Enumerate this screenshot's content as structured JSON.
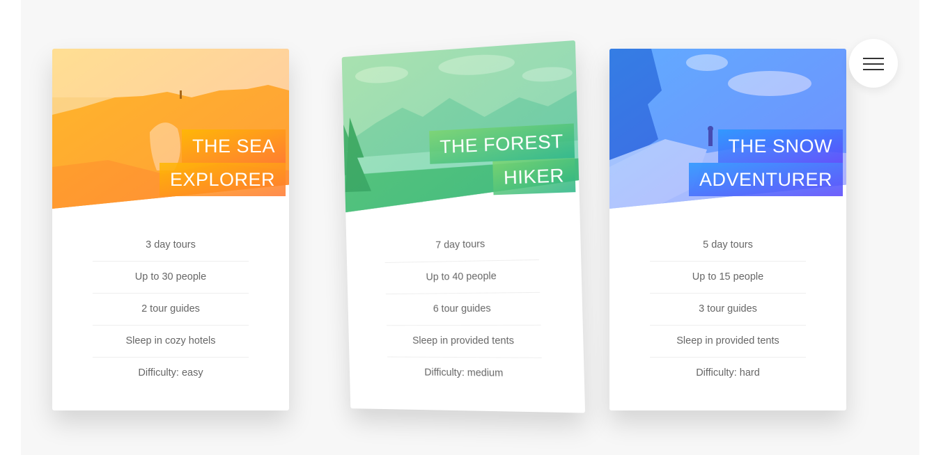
{
  "colors": {
    "sea_light": "#ffb900",
    "sea_dark": "#ff7730",
    "forest_light": "#7ed56f",
    "forest_dark": "#28b485",
    "snow_light": "#2998ff",
    "snow_dark": "#5643fa"
  },
  "nav": {
    "icon": "hamburger-menu-icon"
  },
  "cards": [
    {
      "heading": [
        "THE SEA",
        "EXPLORER"
      ],
      "details": [
        "3 day tours",
        "Up to 30 people",
        "2 tour guides",
        "Sleep in cozy hotels",
        "Difficulty: easy"
      ]
    },
    {
      "heading": [
        "THE FOREST",
        "HIKER"
      ],
      "details": [
        "7 day tours",
        "Up to 40 people",
        "6 tour guides",
        "Sleep in provided tents",
        "Difficulty: medium"
      ]
    },
    {
      "heading": [
        "THE SNOW",
        "ADVENTURER"
      ],
      "details": [
        "5 day tours",
        "Up to 15 people",
        "3 tour guides",
        "Sleep in provided tents",
        "Difficulty: hard"
      ]
    }
  ]
}
